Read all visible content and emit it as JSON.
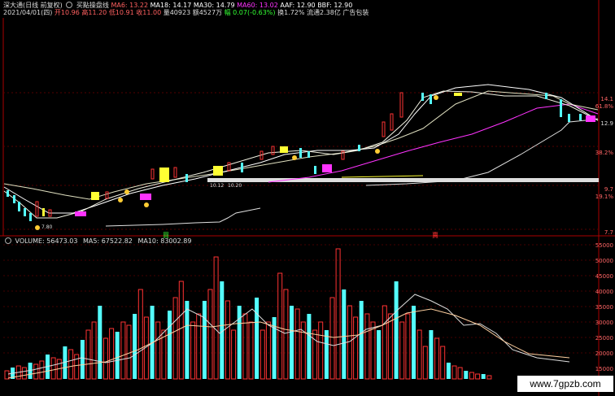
{
  "header": {
    "stock": "深大通(日线 前复权)",
    "indicator": "买點操盘线",
    "ma6": "MA6: 13.22",
    "ma18": "MA18: 14.17",
    "ma30": "MA30: 14.79",
    "ma60": "MA60: 13.02",
    "aaf": "AAF: 12.90",
    "bbf": "BBF: 12.90",
    "date": "2021/04/01(四)",
    "open": "开10.96",
    "high": "高11.20",
    "low": "低10.91",
    "close": "收11.00",
    "vol": "量40923",
    "amount": "额4527万",
    "change": "幅 0.07(-0.63%)",
    "turnover": "换1.72%",
    "float_cap": "流通2.38亿",
    "sector": "广告包装"
  },
  "volume_header": {
    "volume": "VOLUME: 56473.03",
    "ma5": "MA5: 67522.82",
    "ma10": "MA10: 83002.89"
  },
  "price_axis": [
    "14.1",
    "61.8%",
    "12.9",
    "38.2%",
    "9.7",
    "19.1%",
    "7.7"
  ],
  "volume_axis": [
    "55000",
    "50000",
    "45000",
    "40000",
    "35000",
    "30000",
    "25000",
    "20000",
    "15000"
  ],
  "labels": {
    "buy": "買",
    "sell": "賣",
    "low_price": "7.80",
    "mid_price": "10.12",
    "mid_price2": "10.20"
  },
  "watermark": "www.7gpzb.com",
  "colors": {
    "ma60": "#ff33ff",
    "up": "#ff3333",
    "down": "#54ffff",
    "yellow": "#ffff33"
  }
}
